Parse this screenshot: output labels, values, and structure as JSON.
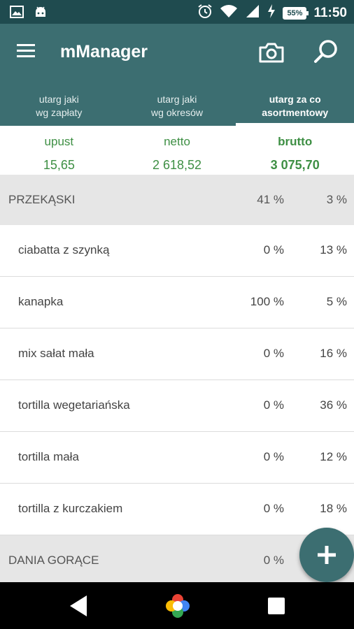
{
  "status_bar": {
    "time": "11:50",
    "battery": "55%",
    "left_icons": [
      "image-icon",
      "android-icon"
    ],
    "right_icons": [
      "alarm-icon",
      "wifi-icon",
      "signal-icon",
      "charging-icon",
      "battery-icon"
    ]
  },
  "app_bar": {
    "title": "mManager",
    "icons": [
      "menu-icon",
      "camera-icon",
      "search-icon"
    ]
  },
  "tabs": [
    {
      "label": "utarg jaki\nwg zapłaty",
      "active": false
    },
    {
      "label": "utarg jaki\nwg okresów",
      "active": false
    },
    {
      "label": "utarg za co\nasortmentowy",
      "active": true
    }
  ],
  "summary": [
    {
      "label": "upust",
      "value": "15,65"
    },
    {
      "label": "netto",
      "value": "2 618,52"
    },
    {
      "label": "brutto",
      "value": "3 075,70"
    }
  ],
  "rows": [
    {
      "name": "PRZEKĄSKI",
      "p1": "41 %",
      "p2": "3 %",
      "group": true
    },
    {
      "name": "ciabatta z szynką",
      "p1": "0 %",
      "p2": "13 %",
      "group": false
    },
    {
      "name": "kanapka",
      "p1": "100 %",
      "p2": "5 %",
      "group": false
    },
    {
      "name": "mix sałat mała",
      "p1": "0 %",
      "p2": "16 %",
      "group": false
    },
    {
      "name": "tortilla wegetariańska",
      "p1": "0 %",
      "p2": "36 %",
      "group": false
    },
    {
      "name": "tortilla mała",
      "p1": "0 %",
      "p2": "12 %",
      "group": false
    },
    {
      "name": "tortilla z kurczakiem",
      "p1": "0 %",
      "p2": "18 %",
      "group": false
    },
    {
      "name": "DANIA GORĄCE",
      "p1": "0 %",
      "p2": "",
      "group": true
    }
  ],
  "fab": {
    "icon": "plus-icon"
  },
  "nav_bar": {
    "icons": [
      "back-icon",
      "home-icon",
      "recents-icon"
    ]
  },
  "colors": {
    "primary": "#3c6e71",
    "status_bar": "#1f4b4f",
    "accent_green": "#3e8f44",
    "group_bg": "#e6e6e6"
  }
}
